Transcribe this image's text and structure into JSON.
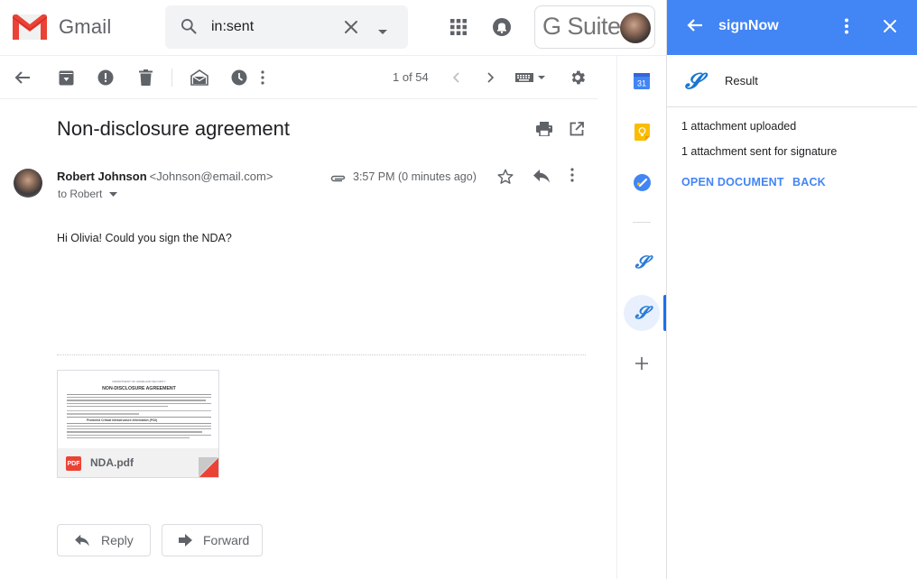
{
  "header": {
    "app_name": "Gmail",
    "search_value": "in:sent",
    "gsuite_label": "G Suite"
  },
  "toolbar": {
    "pager": "1 of 54"
  },
  "message": {
    "subject": "Non-disclosure agreement",
    "sender_name": "Robert Johnson",
    "sender_email": "<Johnson@email.com>",
    "to_line": "to Robert",
    "time": "3:57 PM (0 minutes ago)",
    "body": "Hi Olivia! Could you sign the NDA?",
    "attachment": {
      "filename": "NDA.pdf",
      "type_badge": "PDF",
      "preview_header": "DEPARTMENT OF HOMELAND SECURITY",
      "preview_title": "NON-DISCLOSURE AGREEMENT",
      "preview_section": "Protected Critical Infrastructure Information (PCII)"
    },
    "reply_label": "Reply",
    "forward_label": "Forward"
  },
  "rail": {
    "calendar_day": "31"
  },
  "panel": {
    "title": "signNow",
    "section": "Result",
    "lines": [
      "1 attachment uploaded",
      "1 attachment sent for signature"
    ],
    "open_document_label": "OPEN DOCUMENT",
    "back_label": "BACK"
  },
  "colors": {
    "accent_blue": "#4285f4",
    "gmail_red": "#ea4335",
    "icon_gray": "#5f6368"
  }
}
